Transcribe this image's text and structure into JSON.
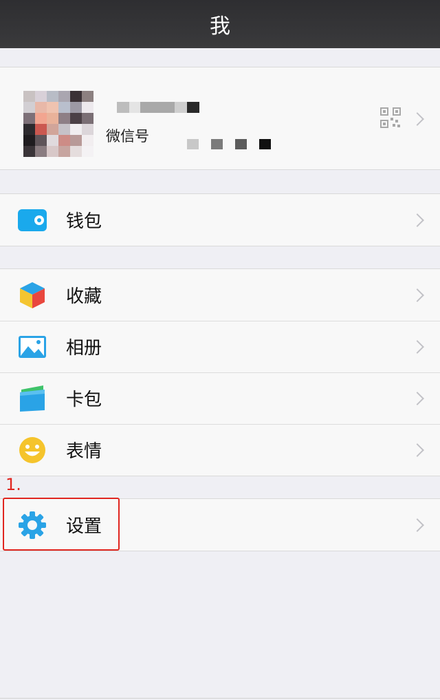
{
  "header": {
    "title": "我"
  },
  "profile": {
    "wechat_id_label": "微信号"
  },
  "groups": {
    "wallet": {
      "label": "钱包"
    },
    "collections": [
      {
        "label": "收藏"
      },
      {
        "label": "相册"
      },
      {
        "label": "卡包"
      },
      {
        "label": "表情"
      }
    ],
    "settings": {
      "label": "设置"
    }
  },
  "annotation": {
    "step": "1."
  },
  "colors": {
    "navbar": "#333336",
    "accent_blue": "#1aa9ec",
    "annotation_red": "#e0251f"
  }
}
